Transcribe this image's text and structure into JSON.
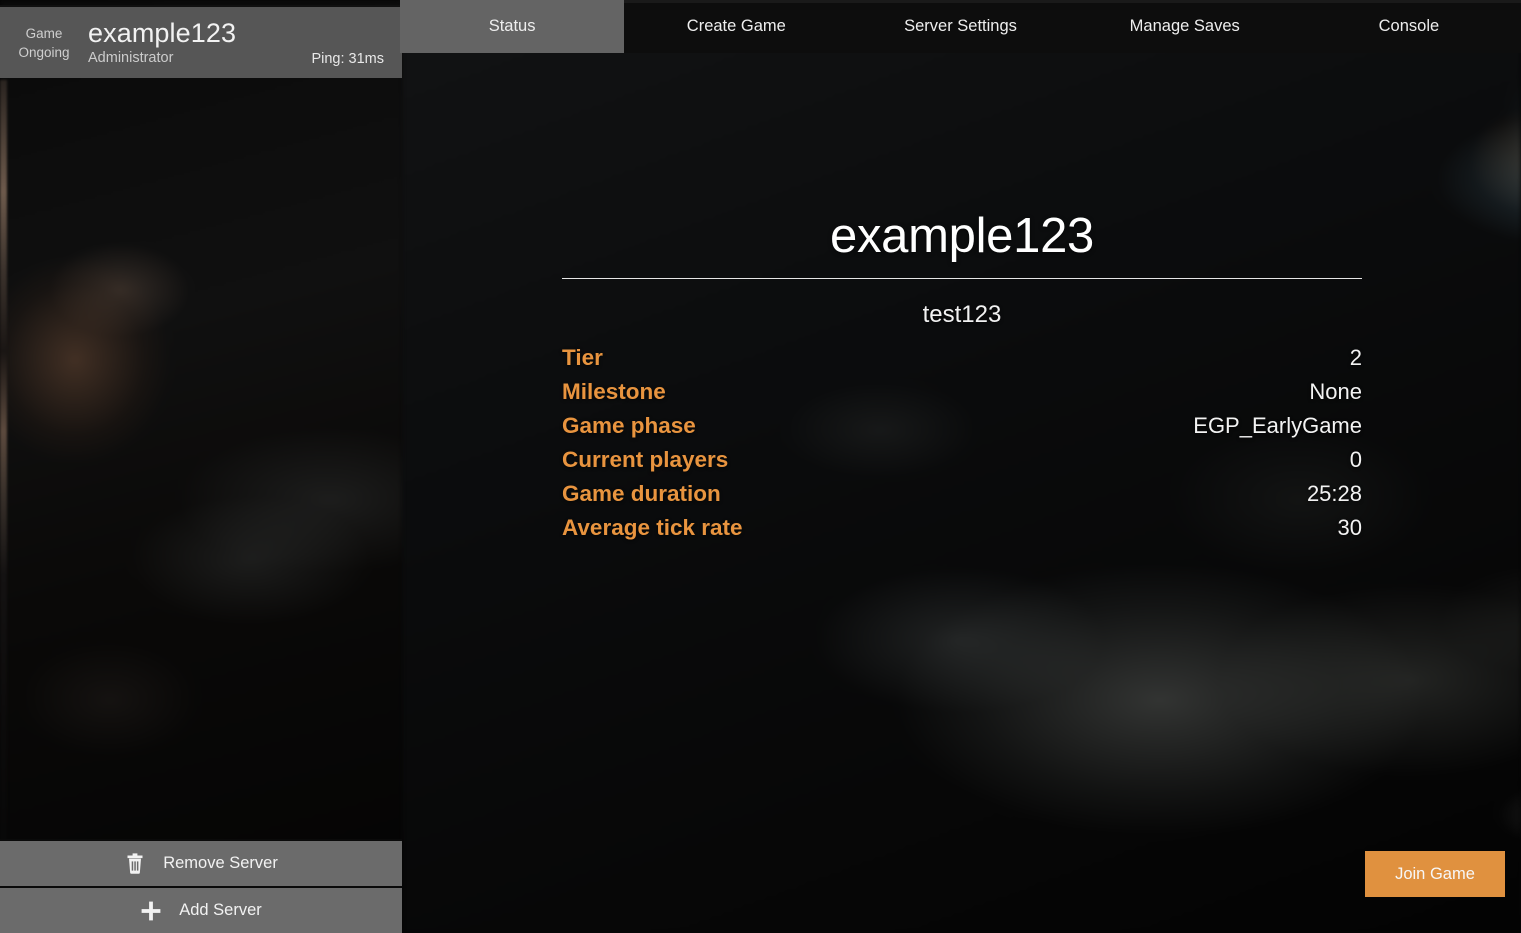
{
  "server_card": {
    "status_line1": "Game",
    "status_line2": "Ongoing",
    "name": "example123",
    "role": "Administrator",
    "ping": "Ping: 31ms"
  },
  "left_buttons": [
    {
      "label": "Remove Server",
      "icon": "trash-icon"
    },
    {
      "label": "Add Server",
      "icon": "plus-icon"
    }
  ],
  "tabs": [
    {
      "label": "Status",
      "active": true
    },
    {
      "label": "Create Game",
      "active": false
    },
    {
      "label": "Server Settings",
      "active": false
    },
    {
      "label": "Manage Saves",
      "active": false
    },
    {
      "label": "Console",
      "active": false
    }
  ],
  "status_panel": {
    "title": "example123",
    "subtitle": "test123",
    "rows": [
      {
        "label": "Tier",
        "value": "2"
      },
      {
        "label": "Milestone",
        "value": "None"
      },
      {
        "label": "Game phase",
        "value": "EGP_EarlyGame"
      },
      {
        "label": "Current players",
        "value": "0"
      },
      {
        "label": "Game duration",
        "value": "25:28"
      },
      {
        "label": "Average tick rate",
        "value": "30"
      }
    ]
  },
  "join_button": {
    "label": "Join Game"
  },
  "colors": {
    "accent_orange": "#e8943f",
    "join_button_bg": "#e0913f",
    "header_bg": "#565656",
    "active_tab_bg": "#646464",
    "tabbar_bg": "#0d0d0d",
    "button_bg": "#6b6b6b"
  }
}
